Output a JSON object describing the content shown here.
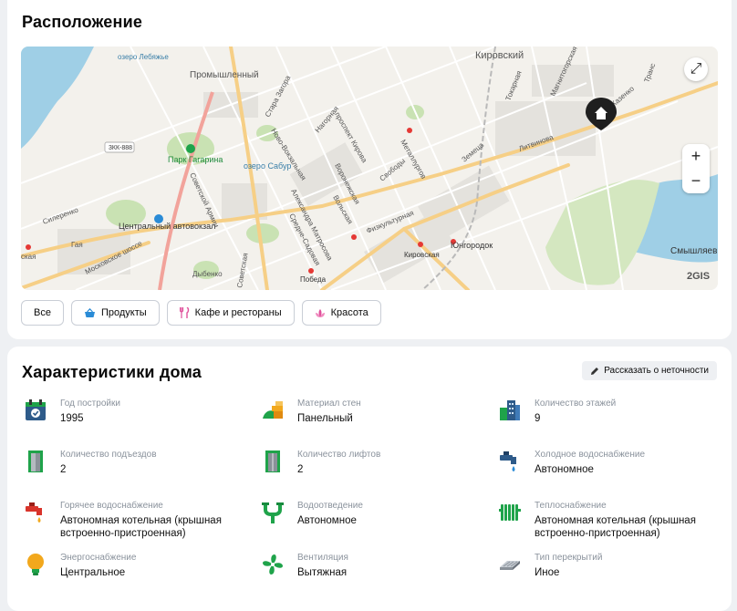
{
  "location": {
    "title": "Расположение",
    "map": {
      "labels": {
        "kirovsky_top": "Кировский",
        "promyshlenny": "Промышленный",
        "lake_lebyazhye": "озеро Лебяжье",
        "park_gagarina": "Парк Гагарина",
        "lake_sabur": "озеро Сабур",
        "central_station": "Центральный автовокзал",
        "yungorodok": "Юнгородок",
        "kirovskaya": "Кировская",
        "pobeda": "Победа",
        "smyshlyaevka": "Смышляев",
        "road_3kk": "3КК-888",
        "moskovskoe": "Московское шоссе",
        "sovetskoy_armii": "Советской Армии",
        "st_zagora": "Стара Загора",
        "pr_kirova": "проспект Кирова",
        "metallurgov": "Металлургов",
        "dybenko": "Дыбенко",
        "gai": "Гая",
        "silerenko": "Силеренко",
        "skaya": "ская",
        "litvinova": "Литвинова",
        "svobody": "Свободы",
        "zemetsa": "Земеца",
        "fizkultury": "Физкультурная",
        "volskaya": "Вольская",
        "matrosova": "Александра Матросова",
        "sredne_sadovaya": "Средне-Садовая",
        "nagornaya": "Нагорная",
        "voronezhskaya": "Воронежская",
        "novo_vokzalnaya": "Ново-Вокзальная",
        "tokarnaya": "Токарная",
        "magnitogorskaya": "Магнитогорская",
        "kazenko": "Казенко",
        "sovetskaya": "Советская",
        "trans": "Транс"
      },
      "attribution": "2GIS",
      "zoom_in": "+",
      "zoom_out": "−",
      "expand_glyph": "⤢"
    },
    "filters": [
      {
        "label": "Все",
        "icon": ""
      },
      {
        "label": "Продукты",
        "icon": "basket-icon"
      },
      {
        "label": "Кафе и рестораны",
        "icon": "fork-knife-icon"
      },
      {
        "label": "Красота",
        "icon": "lotus-icon"
      }
    ]
  },
  "characteristics": {
    "title": "Характеристики дома",
    "report_label": "Рассказать о неточности",
    "items": [
      {
        "label": "Год постройки",
        "value": "1995",
        "icon": "calendar-icon"
      },
      {
        "label": "Материал стен",
        "value": "Панельный",
        "icon": "wall-material-icon"
      },
      {
        "label": "Количество этажей",
        "value": "9",
        "icon": "buildings-icon"
      },
      {
        "label": "Количество подъездов",
        "value": "2",
        "icon": "entrance-door-icon"
      },
      {
        "label": "Количество лифтов",
        "value": "2",
        "icon": "elevator-icon"
      },
      {
        "label": "Холодное водоснабжение",
        "value": "Автономное",
        "icon": "cold-water-tap-icon"
      },
      {
        "label": "Горячее водоснабжение",
        "value": "Автономная котельная (крышная встроенно-пристроенная)",
        "icon": "hot-water-tap-icon"
      },
      {
        "label": "Водоотведение",
        "value": "Автономное",
        "icon": "drain-pipe-icon"
      },
      {
        "label": "Теплоснабжение",
        "value": "Автономная котельная (крышная встроенно-пристроенная)",
        "icon": "radiator-icon"
      },
      {
        "label": "Энергоснабжение",
        "value": "Центральное",
        "icon": "light-bulb-icon"
      },
      {
        "label": "Вентиляция",
        "value": "Вытяжная",
        "icon": "fan-icon"
      },
      {
        "label": "Тип перекрытий",
        "value": "Иное",
        "icon": "floor-slab-icon"
      }
    ]
  },
  "colors": {
    "accent_green": "#1fa34a",
    "water": "#9fcfe6",
    "park": "#c9e2b3",
    "road_major": "#f6cf86",
    "road_red": "#f2a39b",
    "map_bg": "#f3f1ec",
    "pin": "#1f1f1f"
  }
}
